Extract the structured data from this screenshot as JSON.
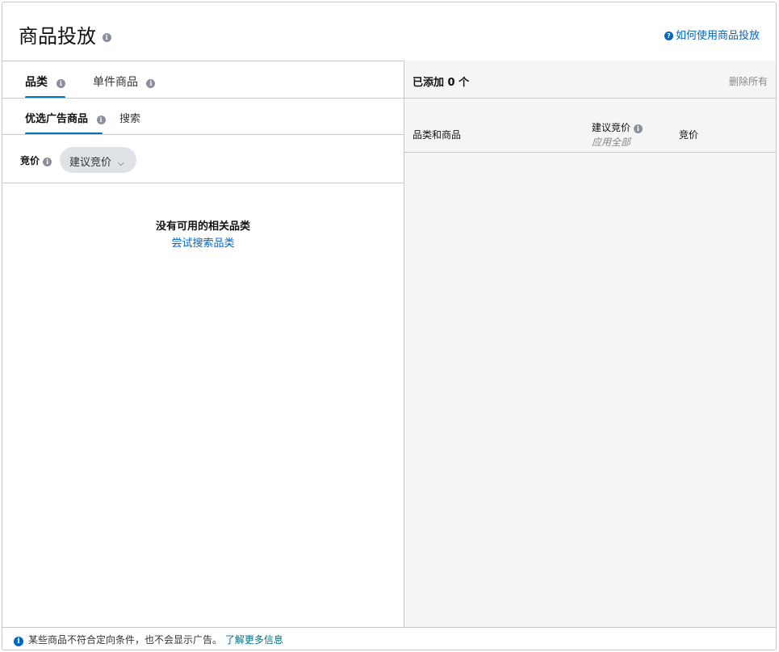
{
  "header": {
    "title": "商品投放",
    "help_link": "如何使用商品投放"
  },
  "left": {
    "tabs": [
      {
        "label": "品类",
        "active": true
      },
      {
        "label": "单件商品",
        "active": false
      }
    ],
    "subtabs": [
      {
        "label": "优选广告商品",
        "active": true
      },
      {
        "label": "搜索",
        "active": false
      }
    ],
    "bid_label": "竞价",
    "bid_select": "建议竞价",
    "empty_message": "没有可用的相关品类",
    "empty_link": "尝试搜索品类"
  },
  "right": {
    "added_label": "已添加 0 个",
    "remove_all": "删除所有",
    "columns": {
      "item": "品类和商品",
      "suggested_bid": "建议竞价",
      "apply_all": "应用全部",
      "bid": "竞价"
    }
  },
  "footer": {
    "message": "某些商品不符合定向条件，也不会显示广告。",
    "link": "了解更多信息"
  }
}
